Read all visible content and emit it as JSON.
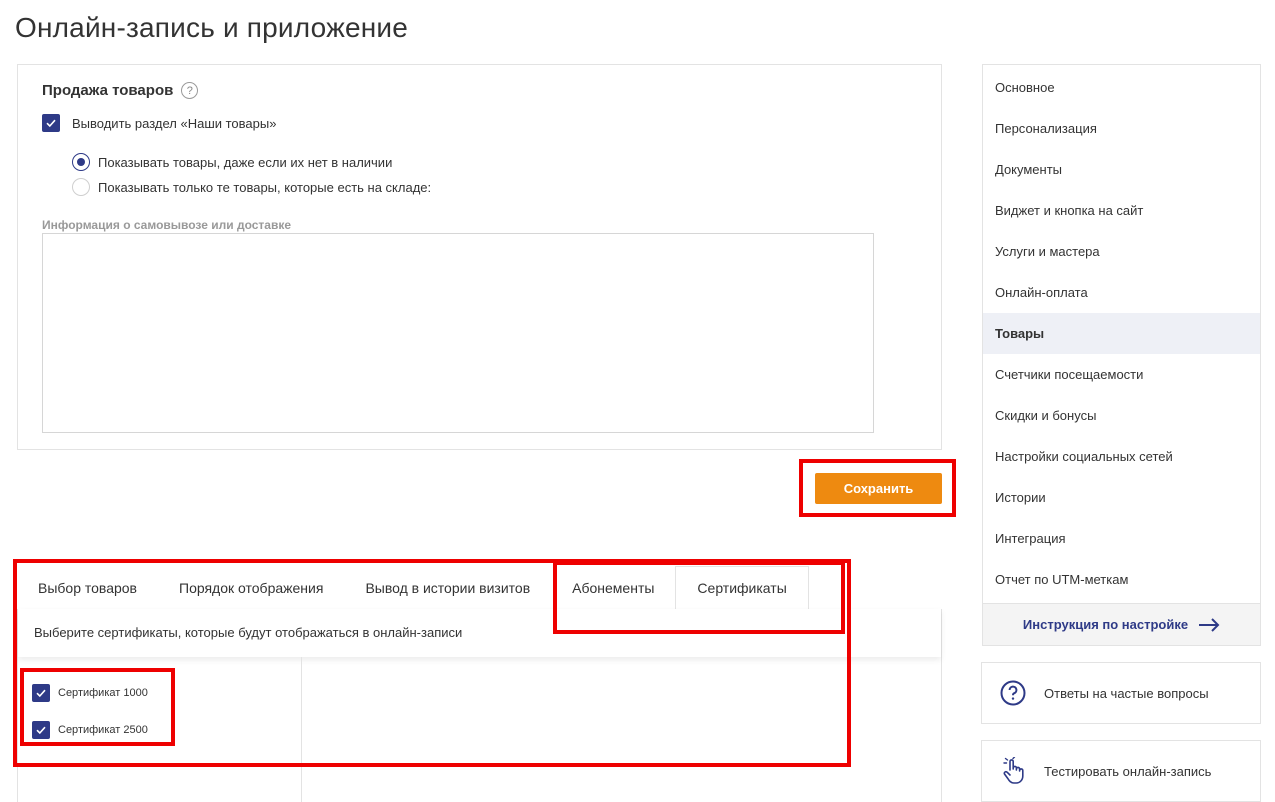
{
  "page": {
    "title": "Онлайн-запись и приложение"
  },
  "goods": {
    "section_title": "Продажа товаров",
    "help_icon_label": "?",
    "show_section_label": "Выводить раздел «Наши товары»",
    "show_section_checked": true,
    "radio_options": [
      {
        "label": "Показывать товары, даже если их нет в наличии",
        "selected": true
      },
      {
        "label": "Показывать только те товары, которые есть на складе:",
        "selected": false
      }
    ],
    "delivery_label": "Информация о самовывозе или доставке",
    "delivery_value": ""
  },
  "actions": {
    "save_label": "Сохранить"
  },
  "tabs": [
    {
      "label": "Выбор товаров",
      "active": false
    },
    {
      "label": "Порядок отображения",
      "active": false
    },
    {
      "label": "Вывод в истории визитов",
      "active": false
    },
    {
      "label": "Абонементы",
      "active": false
    },
    {
      "label": "Сертификаты",
      "active": true
    }
  ],
  "certificates_panel": {
    "hint": "Выберите сертификаты, которые будут отображаться в онлайн-записи",
    "items": [
      {
        "label": "Сертификат 1000",
        "checked": true
      },
      {
        "label": "Сертификат 2500",
        "checked": true
      }
    ]
  },
  "sidebar": {
    "items": [
      {
        "label": "Основное",
        "active": false
      },
      {
        "label": "Персонализация",
        "active": false
      },
      {
        "label": "Документы",
        "active": false
      },
      {
        "label": "Виджет и кнопка на сайт",
        "active": false
      },
      {
        "label": "Услуги и мастера",
        "active": false
      },
      {
        "label": "Онлайн-оплата",
        "active": false
      },
      {
        "label": "Товары",
        "active": true
      },
      {
        "label": "Счетчики посещаемости",
        "active": false
      },
      {
        "label": "Скидки и бонусы",
        "active": false
      },
      {
        "label": "Настройки социальных сетей",
        "active": false
      },
      {
        "label": "Истории",
        "active": false
      },
      {
        "label": "Интеграция",
        "active": false
      },
      {
        "label": "Отчет по UTM-меткам",
        "active": false
      }
    ],
    "instructions_label": "Инструкция по настройке"
  },
  "side_cards": {
    "faq_label": "Ответы на частые вопросы",
    "faq_icon": "question-circle-icon",
    "test_label": "Тестировать онлайн-запись",
    "test_icon": "pointer-hand-icon"
  },
  "colors": {
    "accent": "#2e3a87",
    "save_button": "#ee8a10",
    "annotation": "#ee0000",
    "active_nav_bg": "#eef0f6"
  }
}
